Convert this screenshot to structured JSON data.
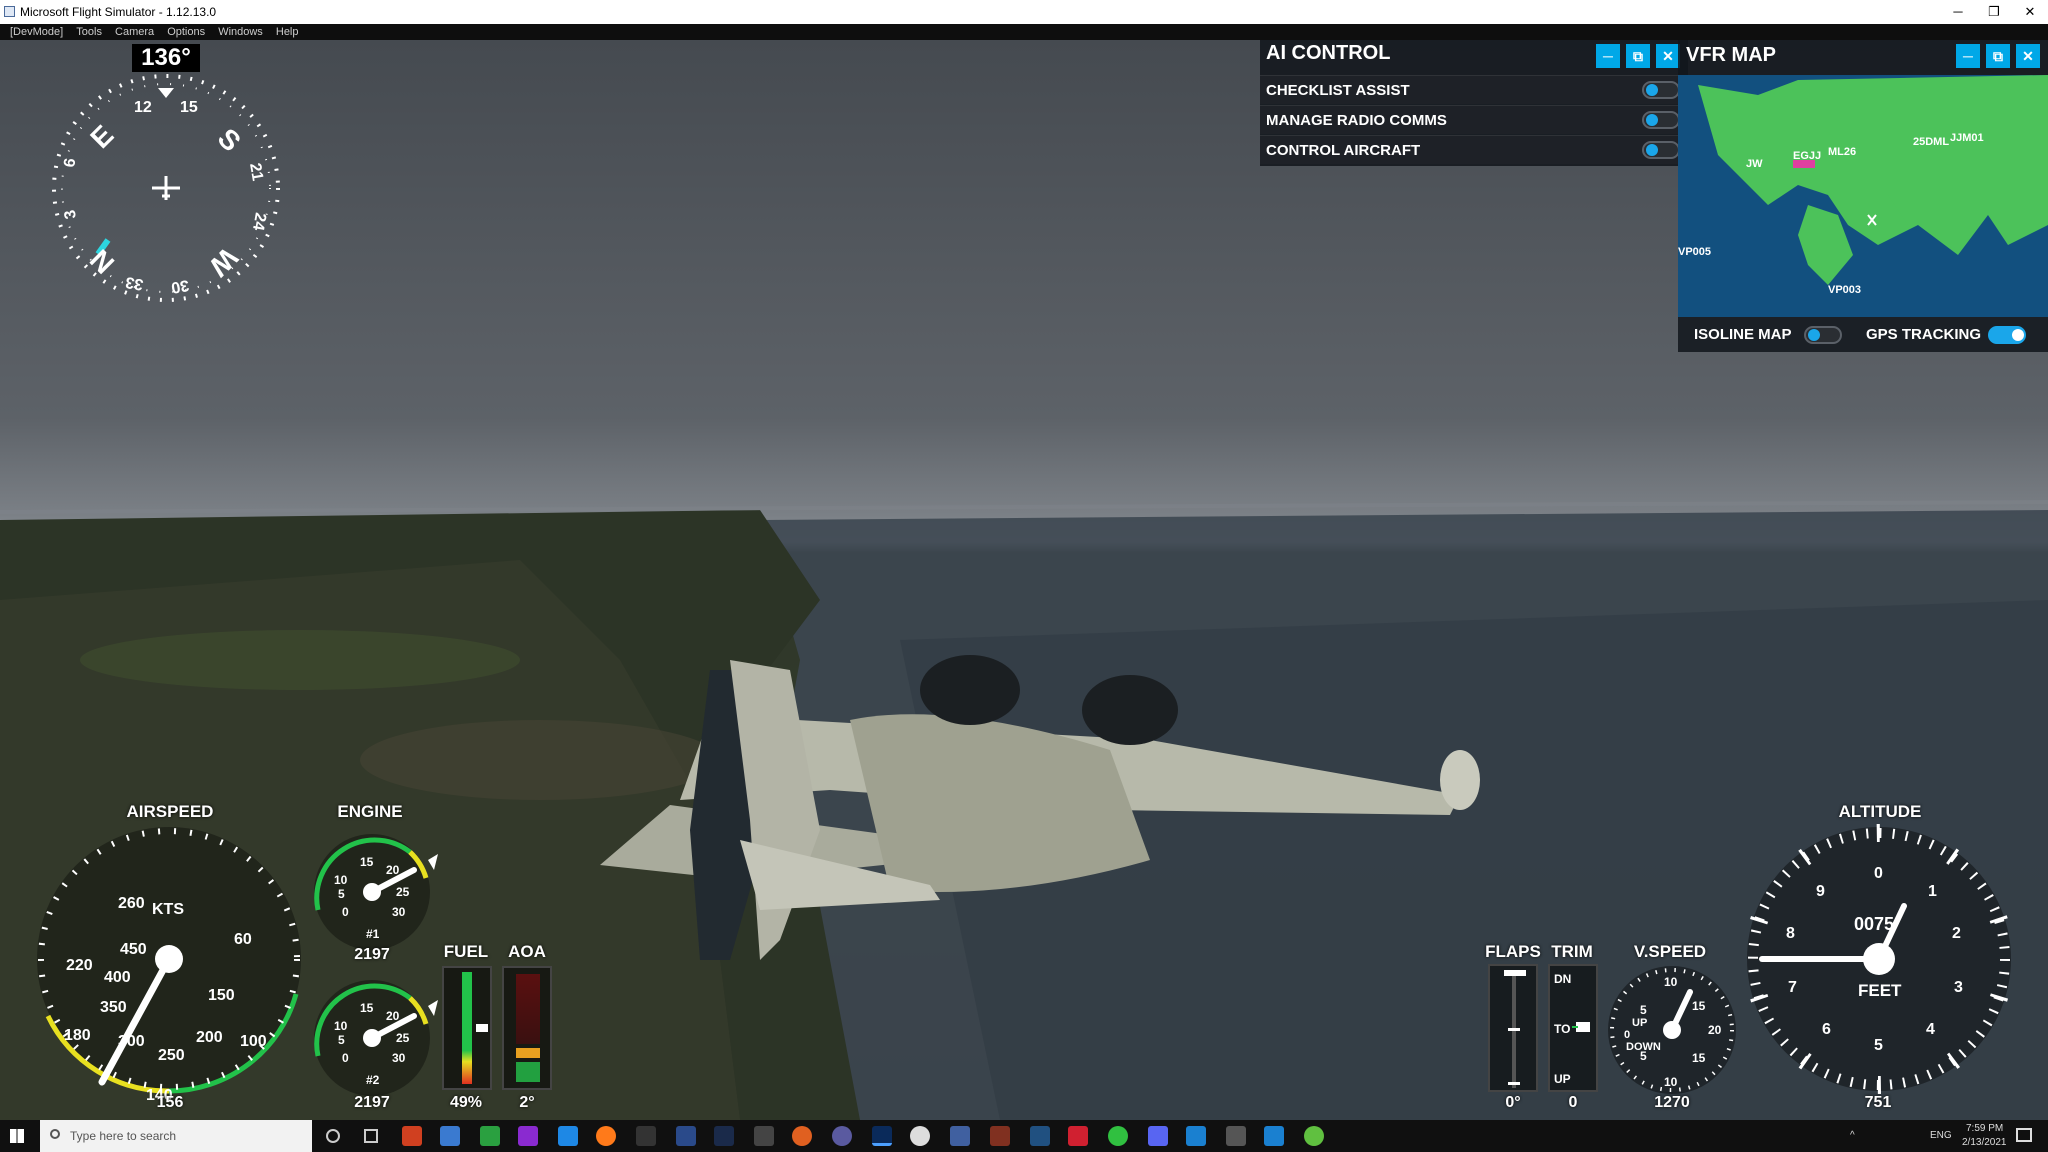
{
  "window": {
    "title": "Microsoft Flight Simulator - 1.12.13.0",
    "min": "─",
    "restore": "❐",
    "close": "✕"
  },
  "menu": [
    "[DevMode]",
    "Tools",
    "Camera",
    "Options",
    "Windows",
    "Help"
  ],
  "compass": {
    "heading": "136°",
    "cardinals": [
      "E",
      "S",
      "W",
      "N"
    ],
    "ticks": [
      "12",
      "15",
      "21",
      "24",
      "30",
      "33",
      "3",
      "6"
    ]
  },
  "ai_control": {
    "title": "AI CONTROL",
    "items": [
      {
        "label": "CHECKLIST ASSIST",
        "on": false
      },
      {
        "label": "MANAGE RADIO COMMS",
        "on": false
      },
      {
        "label": "CONTROL AIRCRAFT",
        "on": false
      }
    ]
  },
  "vfr_map": {
    "title": "VFR MAP",
    "labels": [
      "EGJJ",
      "ML26",
      "25DML",
      "JJM01",
      "JW",
      "VP005",
      "VP003"
    ],
    "isoline_label": "ISOLINE MAP",
    "isoline_on": false,
    "gps_label": "GPS TRACKING",
    "gps_on": true
  },
  "airspeed": {
    "label": "AIRSPEED",
    "unit": "KTS",
    "value": "156",
    "outer": [
      "260",
      "60",
      "220",
      "100",
      "180",
      "140"
    ],
    "inner": [
      "450",
      "400",
      "350",
      "300",
      "250",
      "200",
      "150"
    ]
  },
  "engine": {
    "label": "ENGINE",
    "rpm1": "2197",
    "rpm2": "2197",
    "eng1": "#1",
    "eng2": "#2",
    "scale": [
      "10",
      "15",
      "20",
      "25",
      "30",
      "5",
      "0"
    ]
  },
  "fuel": {
    "label": "FUEL",
    "value": "49%"
  },
  "aoa": {
    "label": "AOA",
    "value": "2°"
  },
  "flaps": {
    "label": "FLAPS",
    "value": "0°"
  },
  "trim": {
    "label": "TRIM",
    "value": "0",
    "dn": "DN",
    "to": "TO",
    "up": "UP"
  },
  "vspeed": {
    "label": "V.SPEED",
    "value": "1270",
    "up": "UP",
    "down": "DOWN",
    "zero": "0",
    "scale": [
      "10",
      "15",
      "20",
      "5"
    ]
  },
  "altitude": {
    "label": "ALTITUDE",
    "unit": "FEET",
    "value": "751",
    "drum": "0075",
    "dial": [
      "0",
      "1",
      "2",
      "3",
      "4",
      "5",
      "6",
      "7",
      "8",
      "9"
    ]
  },
  "taskbar": {
    "search_placeholder": "Type here to search",
    "lang": "ENG",
    "time": "7:59 PM",
    "date": "2/13/2021"
  },
  "colors": {
    "accent": "#00a8e8",
    "arc_green": "#22c24a",
    "arc_yellow": "#e8e020",
    "arc_red": "#e03020",
    "land": "#4cc25a",
    "water": "#12507f"
  }
}
